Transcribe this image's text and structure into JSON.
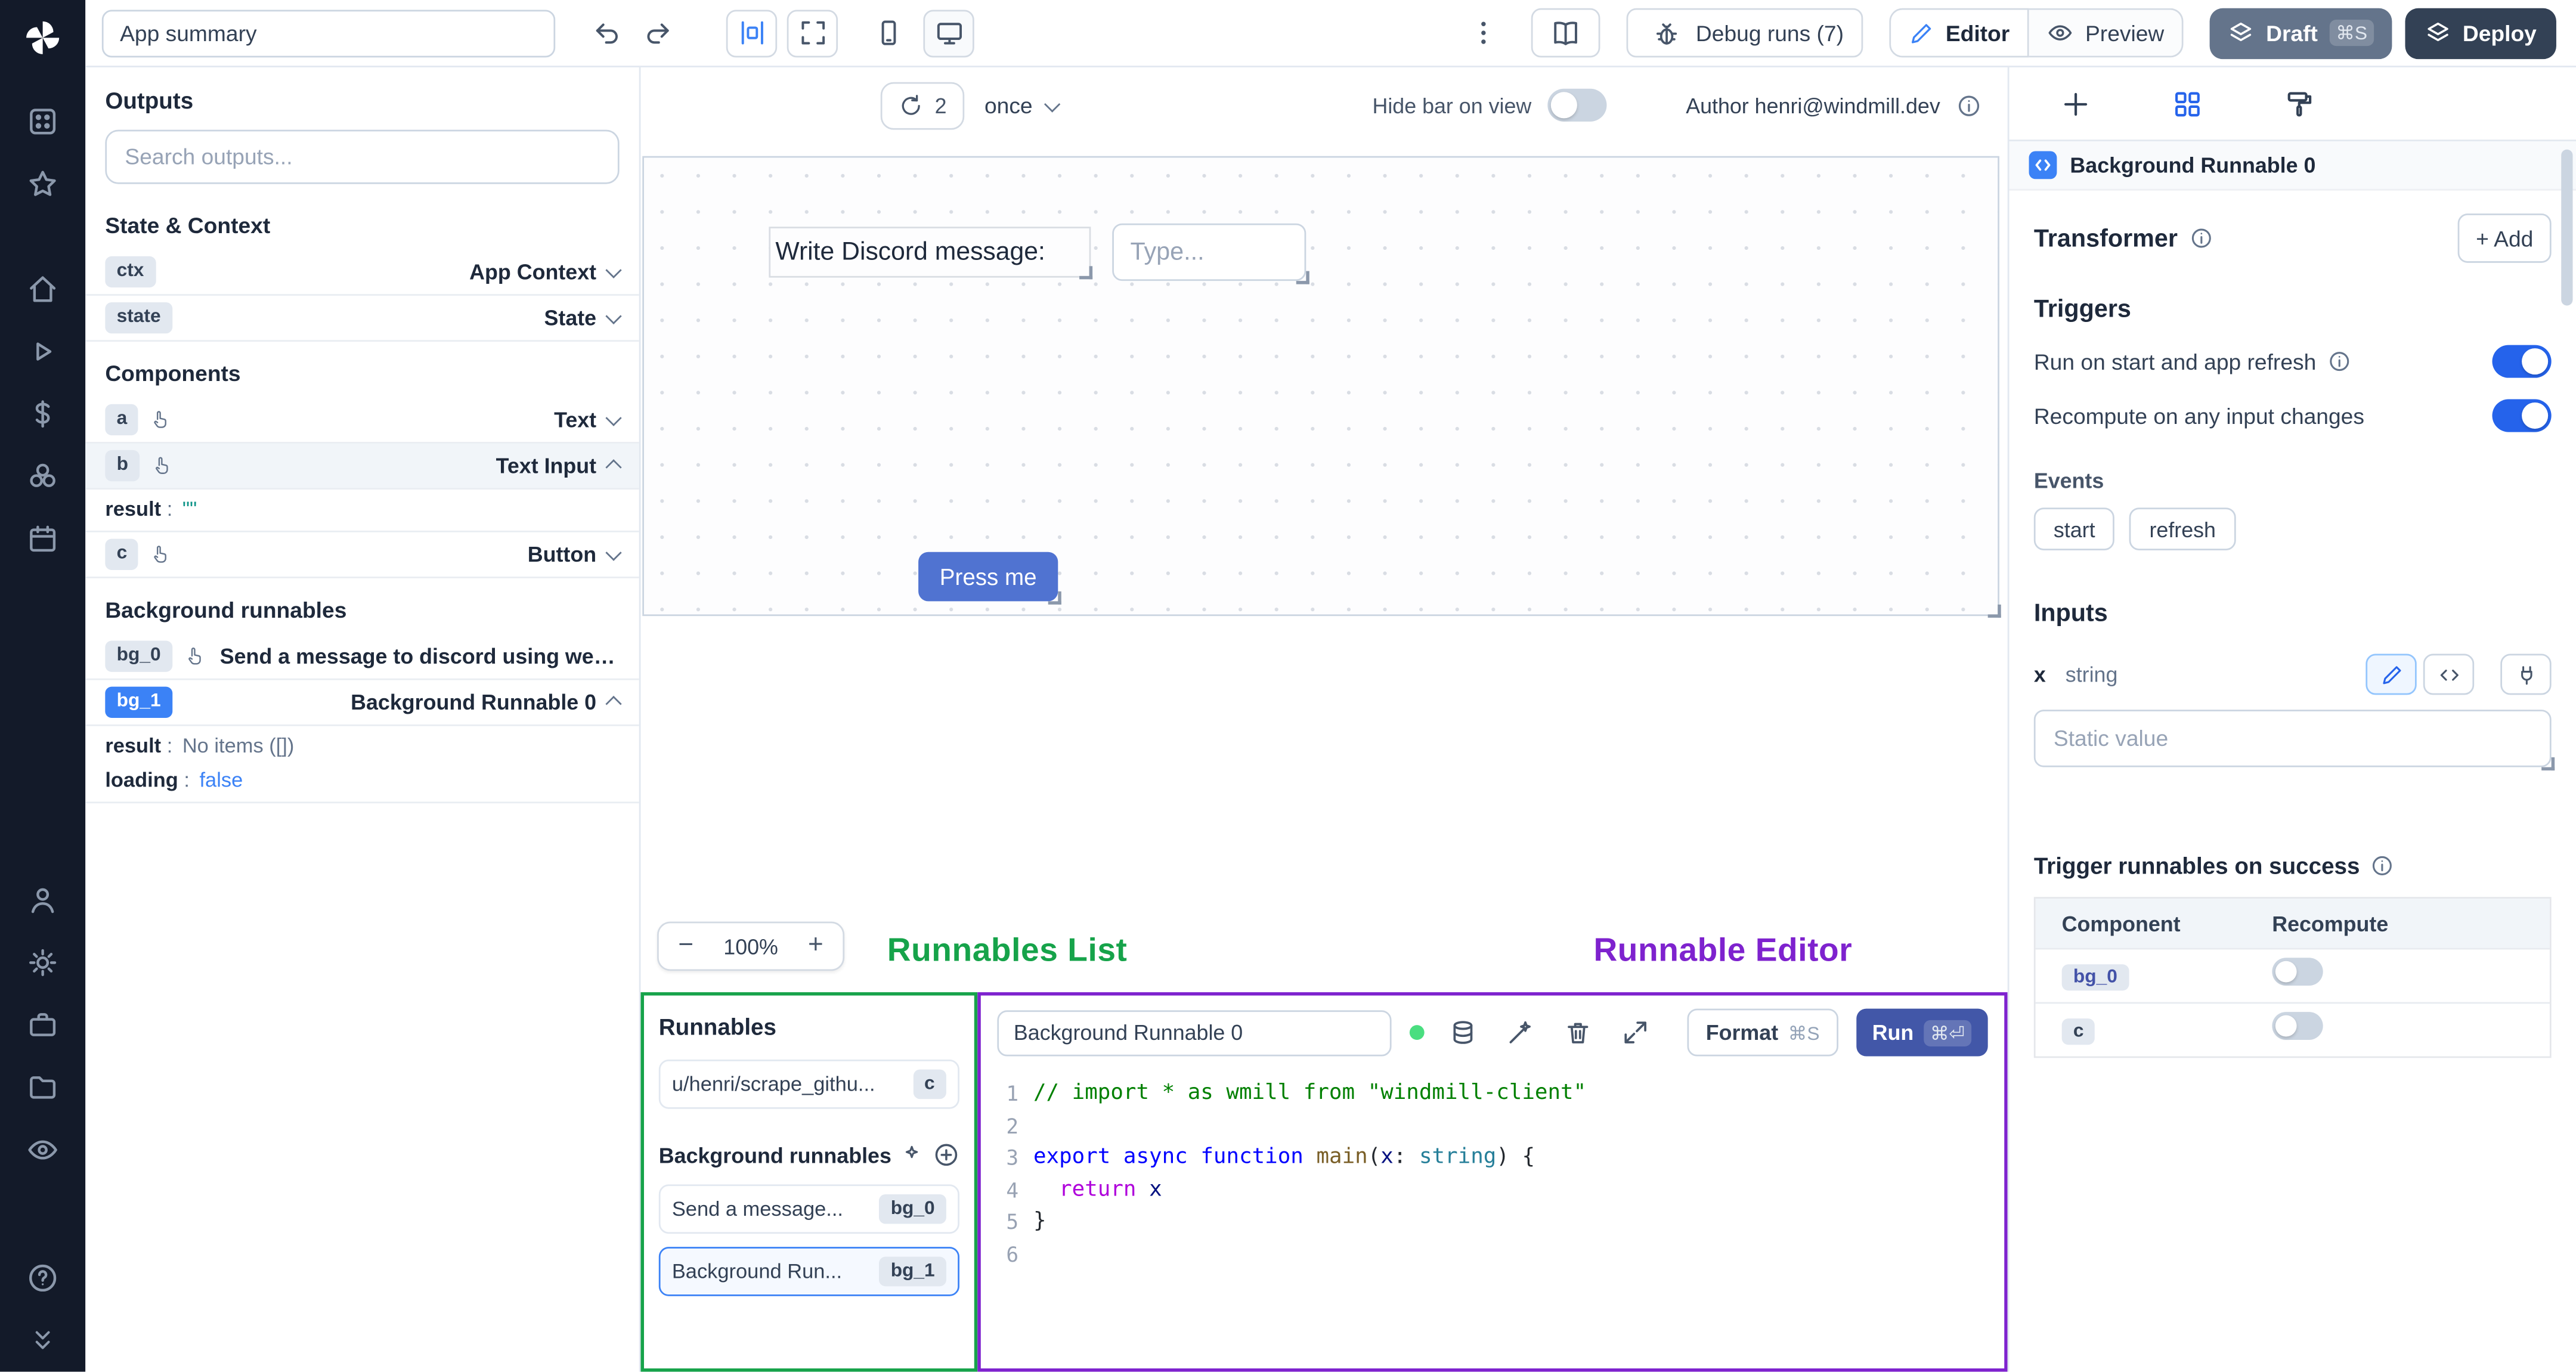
{
  "colors": {
    "accent": "#3b82f6",
    "annotation_green": "#16a34a",
    "annotation_purple": "#7e22ce",
    "run_button": "#4257a8",
    "draft_button": "#64748b",
    "deploy_button": "#334155",
    "canvas_button": "#5073d1"
  },
  "topbar": {
    "summary_value": "App summary",
    "debug_runs": "Debug runs (7)",
    "editor": "Editor",
    "preview": "Preview",
    "draft": "Draft",
    "draft_shortcut": "⌘S",
    "deploy": "Deploy"
  },
  "canvas": {
    "refresh_count": "2",
    "frequency": "once",
    "hide_bar": "Hide bar on view",
    "author": "Author henri@windmill.dev",
    "text_component": "Write Discord message:",
    "input_placeholder": "Type...",
    "button_label": "Press me",
    "zoom_out": "−",
    "zoom_level": "100%",
    "zoom_in": "+"
  },
  "annotations": {
    "runnables_list": "Runnables List",
    "runnable_editor": "Runnable Editor"
  },
  "outputs": {
    "title": "Outputs",
    "search_placeholder": "Search outputs...",
    "sections": [
      "State & Context",
      "Components",
      "Background runnables"
    ],
    "ctx": {
      "badge": "ctx",
      "label": "App Context"
    },
    "state": {
      "badge": "state",
      "label": "State"
    },
    "a": {
      "badge": "a",
      "label": "Text"
    },
    "b": {
      "badge": "b",
      "label": "Text Input",
      "result_key": "result",
      "result_value": "\"\""
    },
    "c": {
      "badge": "c",
      "label": "Button"
    },
    "bg0": {
      "badge": "bg_0",
      "label": "Send a message to discord using webhoo"
    },
    "bg1": {
      "badge": "bg_1",
      "label": "Background Runnable 0",
      "result_key": "result",
      "result_value": "No items ([])",
      "loading_key": "loading",
      "loading_value": "false"
    }
  },
  "runnables": {
    "title": "Runnables",
    "item0": {
      "label": "u/henri/scrape_githu...",
      "badge": "c"
    },
    "group_title": "Background runnables",
    "item1": {
      "label": "Send a message...",
      "badge": "bg_0"
    },
    "item2": {
      "label": "Background Run...",
      "badge": "bg_1"
    }
  },
  "editor": {
    "name_value": "Background Runnable 0",
    "format": "Format",
    "format_shortcut": "⌘S",
    "run": "Run",
    "run_shortcut": "⌘⏎",
    "line_numbers": [
      "1",
      "2",
      "3",
      "4",
      "5",
      "6"
    ],
    "code_lines": [
      [
        [
          "// import * as wmill from \"windmill-client\"",
          "cmt"
        ]
      ],
      [],
      [
        [
          "export",
          "kw"
        ],
        [
          " ",
          "pl"
        ],
        [
          "async",
          "kw"
        ],
        [
          " ",
          "pl"
        ],
        [
          "function",
          "kw"
        ],
        [
          " ",
          "pl"
        ],
        [
          "main",
          "fn"
        ],
        [
          "(",
          "pl"
        ],
        [
          "x",
          "prm"
        ],
        [
          ":",
          "pl"
        ],
        [
          " ",
          "pl"
        ],
        [
          "string",
          "typ"
        ],
        [
          ")",
          "pl"
        ],
        [
          " {",
          "pl"
        ]
      ],
      [
        [
          "  ",
          "pl"
        ],
        [
          "return",
          "ctl"
        ],
        [
          " ",
          "pl"
        ],
        [
          "x",
          "prm"
        ]
      ],
      [
        [
          "}",
          "pl"
        ]
      ],
      []
    ]
  },
  "inspector": {
    "header": "Background Runnable 0",
    "transformer": "Transformer",
    "add": "+ Add",
    "triggers": "Triggers",
    "toggle1": "Run on start and app refresh",
    "toggle2": "Recompute on any input changes",
    "events": "Events",
    "event1": "start",
    "event2": "refresh",
    "inputs": "Inputs",
    "field_name": "x",
    "field_type": "string",
    "static_placeholder": "Static value",
    "trigger_success": "Trigger runnables on success",
    "col1": "Component",
    "col2": "Recompute",
    "row1": "bg_0",
    "row2": "c"
  }
}
